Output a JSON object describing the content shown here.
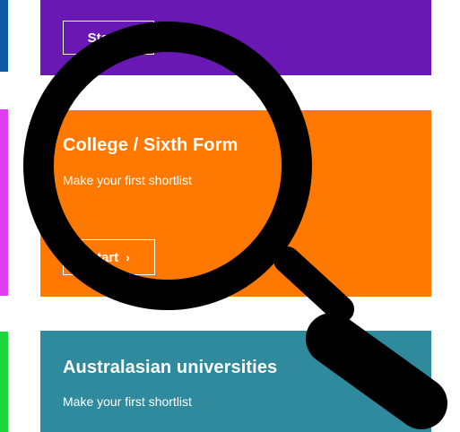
{
  "colors": {
    "purple": "#6a18b4",
    "orange": "#ff7900",
    "teal": "#2e8a9c",
    "stripe_blue": "#0d5aa8",
    "stripe_pink": "#e03cf0",
    "stripe_green": "#1cd83a",
    "magnifier": "#000000"
  },
  "cards": {
    "top": {
      "start_label": "Start"
    },
    "college": {
      "title": "College / Sixth Form",
      "subtitle": "Make your first shortlist",
      "start_label": "Start"
    },
    "australasian": {
      "title": "Australasian universities",
      "subtitle": "Make your first shortlist"
    }
  },
  "overlay": {
    "icon": "magnifier-icon"
  },
  "icons": {
    "chevron": "›"
  }
}
